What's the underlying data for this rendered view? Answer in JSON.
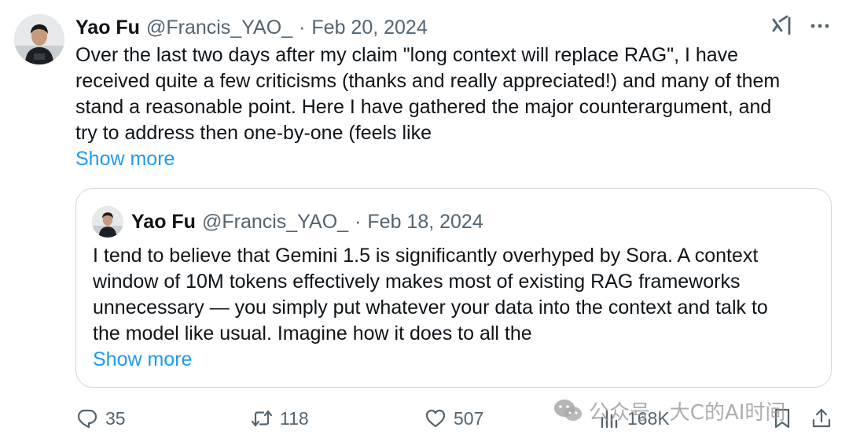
{
  "tweet": {
    "author_name": "Yao Fu",
    "author_handle": "@Francis_YAO_",
    "separator": "·",
    "date": "Feb 20, 2024",
    "text": "Over the last two days after my claim \"long context will replace RAG\", I have\nreceived quite a few criticisms (thanks and really appreciated!) and many of them\nstand a reasonable point. Here I have gathered the major counterargument, and\ntry to address then one-by-one (feels like",
    "show_more": "Show more"
  },
  "quoted_tweet": {
    "author_name": "Yao Fu",
    "author_handle": "@Francis_YAO_",
    "separator": "·",
    "date": "Feb 18, 2024",
    "text": "I tend to believe that Gemini 1.5 is significantly overhyped by Sora. A context\nwindow of 10M tokens effectively makes most of existing RAG frameworks\nunnecessary — you simply put whatever your data into the context and talk to\nthe model like usual. Imagine how it does to all the",
    "show_more": "Show more"
  },
  "actions": {
    "replies": "35",
    "reposts": "118",
    "likes": "507",
    "views": "168K"
  },
  "icons": {
    "top_right": [
      "grok-icon",
      "more-icon"
    ],
    "bar": [
      "reply-icon",
      "repost-icon",
      "like-icon",
      "views-icon",
      "bookmark-icon",
      "share-icon"
    ]
  },
  "watermark": {
    "text": "公众号 · 大C的AI时间"
  },
  "colors": {
    "link": "#1d9bf0",
    "secondary_text": "#536471",
    "primary_text": "#0f1419",
    "border": "#cfd9de"
  }
}
